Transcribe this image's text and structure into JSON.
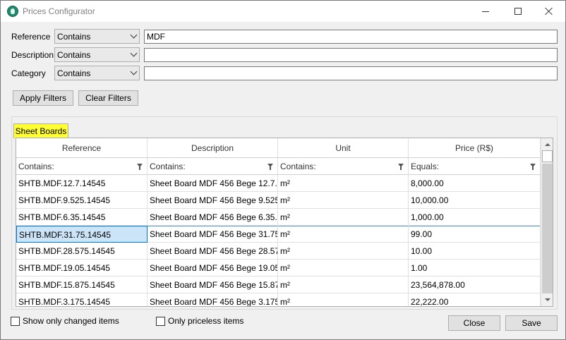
{
  "window": {
    "title": "Prices Configurator",
    "icon": "app-logo-icon",
    "controls": [
      "minimize-icon",
      "maximize-icon",
      "close-icon"
    ]
  },
  "filters": {
    "reference": {
      "label": "Reference",
      "operator": "Contains",
      "value": "MDF"
    },
    "description": {
      "label": "Description",
      "operator": "Contains",
      "value": ""
    },
    "category": {
      "label": "Category",
      "operator": "Contains",
      "value": ""
    }
  },
  "actions": {
    "apply_label": "Apply Filters",
    "clear_label": "Clear Filters"
  },
  "tabs": [
    {
      "label": "Sheet Boards",
      "selected": true,
      "highlight_color": "#ffff33"
    }
  ],
  "grid": {
    "columns": [
      {
        "header": "Reference",
        "filter": "Contains:"
      },
      {
        "header": "Description",
        "filter": "Contains:"
      },
      {
        "header": "Unit",
        "filter": "Contains:"
      },
      {
        "header": "Price (R$)",
        "filter": "Equals:"
      }
    ],
    "rows": [
      {
        "reference": "SHTB.MDF.12.7.14545",
        "description": "Sheet Board MDF 456 Bege 12.7...",
        "unit": "m²",
        "price": "8,000.00"
      },
      {
        "reference": "SHTB.MDF.9.525.14545",
        "description": "Sheet Board MDF 456 Bege 9.525...",
        "unit": "m²",
        "price": "10,000.00"
      },
      {
        "reference": "SHTB.MDF.6.35.14545",
        "description": "Sheet Board MDF 456 Bege 6.35...",
        "unit": "m²",
        "price": "1,000.00"
      },
      {
        "reference": "SHTB.MDF.31.75.14545",
        "description": "Sheet Board MDF 456 Bege 31.75...",
        "unit": "m²",
        "price": "99.00",
        "selected": true
      },
      {
        "reference": "SHTB.MDF.28.575.14545",
        "description": "Sheet Board MDF 456 Bege 28.57...",
        "unit": "m²",
        "price": "10.00"
      },
      {
        "reference": "SHTB.MDF.19.05.14545",
        "description": "Sheet Board MDF 456 Bege 19.05...",
        "unit": "m²",
        "price": "1.00"
      },
      {
        "reference": "SHTB.MDF.15.875.14545",
        "description": "Sheet Board MDF 456 Bege 15.87...",
        "unit": "m²",
        "price": "23,564,878.00"
      },
      {
        "reference": "SHTB.MDF.3.175.14545",
        "description": "Sheet Board MDF 456 Bege 3.175...",
        "unit": "m²",
        "price": "22,222.00"
      }
    ]
  },
  "options": {
    "show_changed_label": "Show only changed items",
    "show_changed_checked": false,
    "priceless_label": "Only priceless items",
    "priceless_checked": false
  },
  "footer": {
    "close_label": "Close",
    "save_label": "Save"
  },
  "colors": {
    "selection": "#cce4f7",
    "selection_border": "#0078d7",
    "tab_highlight": "#ffff33"
  }
}
